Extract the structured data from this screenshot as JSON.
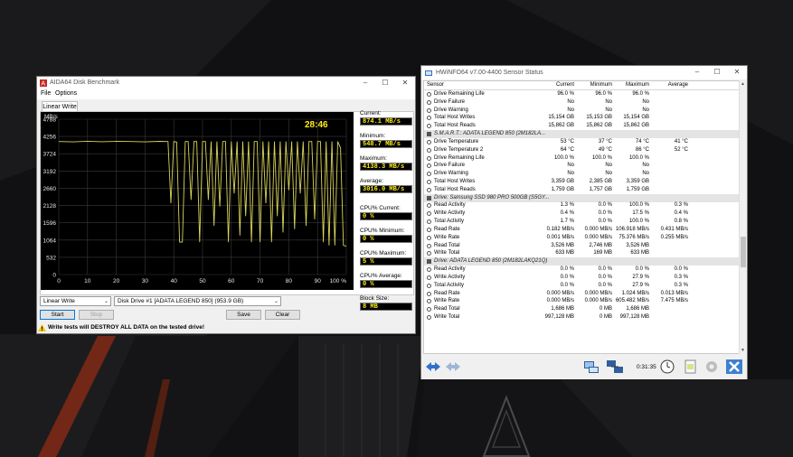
{
  "aida": {
    "title": "AIDA64 Disk Benchmark",
    "menu": [
      "File",
      "Options"
    ],
    "tab": "Linear Write",
    "window_controls": [
      "–",
      "☐",
      "✕"
    ],
    "stats": {
      "current_label": "Current:",
      "current": "874.1 MB/s",
      "minimum_label": "Minimum:",
      "minimum": "548.7 MB/s",
      "maximum_label": "Maximum:",
      "maximum": "4138.3 MB/s",
      "average_label": "Average:",
      "average": "3016.0 MB/s",
      "cpu_current_label": "CPU% Current:",
      "cpu_current": "0 %",
      "cpu_min_label": "CPU% Minimum:",
      "cpu_min": "0 %",
      "cpu_max_label": "CPU% Maximum:",
      "cpu_max": "5 %",
      "cpu_avg_label": "CPU% Average:",
      "cpu_avg": "0 %",
      "block_label": "Block Size:",
      "block": "8 MB"
    },
    "controls": {
      "test_select": "Linear Write",
      "drive_select": "Disk Drive #1  [ADATA LEGEND 850]  (953.9 GB)",
      "start": "Start",
      "stop": "Stop",
      "save": "Save",
      "clear": "Clear"
    },
    "warning": "Write tests will DESTROY ALL DATA on the tested drive!"
  },
  "chart_data": {
    "type": "line",
    "unit_label": "MB/s",
    "timer": "28:46",
    "ylim": [
      0,
      4788
    ],
    "y_ticks": [
      "4788",
      "4256",
      "3724",
      "3192",
      "2660",
      "2128",
      "1596",
      "1064",
      "532",
      "0"
    ],
    "xlim": [
      0,
      100
    ],
    "x_ticks": [
      "0",
      "10",
      "20",
      "30",
      "40",
      "50",
      "60",
      "70",
      "80",
      "90",
      "100 %"
    ],
    "grid": true,
    "line_color": "#d8d45a",
    "series": [
      {
        "x": [
          0,
          5,
          10,
          15,
          20,
          25,
          30,
          35,
          38,
          39,
          40,
          41,
          42,
          43,
          44,
          45,
          46,
          47,
          48,
          49,
          50,
          51,
          52,
          53,
          54,
          55,
          56,
          57,
          58,
          59,
          60,
          61,
          62,
          63,
          64,
          65,
          66,
          67,
          68,
          69,
          70,
          71,
          72,
          73,
          74,
          75,
          76,
          77,
          78,
          79,
          80,
          81,
          82,
          83,
          84,
          85,
          86,
          87,
          88,
          89,
          90,
          91,
          92,
          93,
          94,
          95,
          96,
          97,
          98,
          99,
          100
        ],
        "y": [
          4100,
          4090,
          4110,
          4095,
          4105,
          4100,
          4090,
          4105,
          4100,
          2200,
          4100,
          4080,
          1000,
          1000,
          4100,
          4100,
          2300,
          4100,
          4100,
          1000,
          4100,
          4100,
          2300,
          4100,
          1500,
          4100,
          2100,
          4100,
          4100,
          1000,
          4100,
          2500,
          4100,
          1200,
          4100,
          1800,
          4100,
          1000,
          4100,
          4100,
          1000,
          4100,
          2200,
          4100,
          1000,
          4100,
          1800,
          4100,
          1300,
          4100,
          2600,
          4100,
          1400,
          4100,
          2500,
          4100,
          1500,
          4100,
          4100,
          1700,
          4100,
          4100,
          1000,
          4100,
          900,
          4100,
          900,
          4100,
          3900,
          900,
          874
        ]
      }
    ]
  },
  "hwinfo": {
    "title": "HWiNFO64 v7.00-4400 Sensor Status",
    "window_controls": [
      "–",
      "☐",
      "✕"
    ],
    "headers": [
      "Sensor",
      "Current",
      "Minimum",
      "Maximum",
      "Average"
    ],
    "rows": [
      {
        "name": "Drive Remaining Life",
        "cur": "96.0 %",
        "min": "96.0 %",
        "max": "96.0 %",
        "avg": ""
      },
      {
        "name": "Drive Failure",
        "cur": "No",
        "min": "No",
        "max": "No",
        "avg": ""
      },
      {
        "name": "Drive Warning",
        "cur": "No",
        "min": "No",
        "max": "No",
        "avg": ""
      },
      {
        "name": "Total Host Writes",
        "cur": "15,154 GB",
        "min": "15,153 GB",
        "max": "15,154 GB",
        "avg": ""
      },
      {
        "name": "Total Host Reads",
        "cur": "15,862 GB",
        "min": "15,862 GB",
        "max": "15,862 GB",
        "avg": ""
      },
      {
        "group": "S.M.A.R.T.: ADATA LEGEND 850 (2M182LA..."
      },
      {
        "name": "Drive Temperature",
        "cur": "53 °C",
        "min": "37 °C",
        "max": "74 °C",
        "avg": "41 °C"
      },
      {
        "name": "Drive Temperature 2",
        "cur": "64 °C",
        "min": "49 °C",
        "max": "86 °C",
        "avg": "52 °C"
      },
      {
        "name": "Drive Remaining Life",
        "cur": "100.0 %",
        "min": "100.0 %",
        "max": "100.0 %",
        "avg": ""
      },
      {
        "name": "Drive Failure",
        "cur": "No",
        "min": "No",
        "max": "No",
        "avg": ""
      },
      {
        "name": "Drive Warning",
        "cur": "No",
        "min": "No",
        "max": "No",
        "avg": ""
      },
      {
        "name": "Total Host Writes",
        "cur": "3,359 GB",
        "min": "2,385 GB",
        "max": "3,359 GB",
        "avg": ""
      },
      {
        "name": "Total Host Reads",
        "cur": "1,759 GB",
        "min": "1,757 GB",
        "max": "1,759 GB",
        "avg": ""
      },
      {
        "group": "Drive: Samsung SSD 980 PRO 500GB (S5GY..."
      },
      {
        "name": "Read Activity",
        "cur": "1.3 %",
        "min": "0.0 %",
        "max": "100.0 %",
        "avg": "0.3 %"
      },
      {
        "name": "Write Activity",
        "cur": "0.4 %",
        "min": "0.0 %",
        "max": "17.5 %",
        "avg": "0.4 %"
      },
      {
        "name": "Total Activity",
        "cur": "1.7 %",
        "min": "0.0 %",
        "max": "100.0 %",
        "avg": "0.8 %"
      },
      {
        "name": "Read Rate",
        "cur": "0.182 MB/s",
        "min": "0.000 MB/s",
        "max": "106.918 MB/s",
        "avg": "0.431 MB/s"
      },
      {
        "name": "Write Rate",
        "cur": "0.001 MB/s",
        "min": "0.000 MB/s",
        "max": "75.376 MB/s",
        "avg": "0.255 MB/s"
      },
      {
        "name": "Read Total",
        "cur": "3,526 MB",
        "min": "2,746 MB",
        "max": "3,526 MB",
        "avg": ""
      },
      {
        "name": "Write Total",
        "cur": "633 MB",
        "min": "169 MB",
        "max": "633 MB",
        "avg": ""
      },
      {
        "group": "Drive: ADATA LEGEND 850 (2M182LAKQ21Q)"
      },
      {
        "name": "Read Activity",
        "cur": "0.0 %",
        "min": "0.0 %",
        "max": "0.0 %",
        "avg": "0.0 %"
      },
      {
        "name": "Write Activity",
        "cur": "0.0 %",
        "min": "0.0 %",
        "max": "27.9 %",
        "avg": "0.3 %"
      },
      {
        "name": "Total Activity",
        "cur": "0.0 %",
        "min": "0.0 %",
        "max": "27.9 %",
        "avg": "0.3 %"
      },
      {
        "name": "Read Rate",
        "cur": "0.000 MB/s",
        "min": "0.000 MB/s",
        "max": "1.024 MB/s",
        "avg": "0.013 MB/s"
      },
      {
        "name": "Write Rate",
        "cur": "0.000 MB/s",
        "min": "0.000 MB/s",
        "max": "605.482 MB/s",
        "avg": "7.475 MB/s"
      },
      {
        "name": "Read Total",
        "cur": "1,686 MB",
        "min": "0 MB",
        "max": "1,686 MB",
        "avg": ""
      },
      {
        "name": "Write Total",
        "cur": "997,128 MB",
        "min": "0 MB",
        "max": "997,128 MB",
        "avg": ""
      }
    ],
    "elapsed": "0:31:35",
    "toolbar_icons": [
      "nav-arrows-icon",
      "nav-arrows-disabled-icon",
      "network-computer-icon",
      "network-link-icon",
      "clock-icon",
      "report-icon",
      "settings-icon",
      "close-x-icon"
    ]
  },
  "colors": {
    "chart_bg": "#000000",
    "chart_line": "#d8d45a",
    "value_text": "#ffec1a",
    "accent_blue": "#0078d7"
  }
}
